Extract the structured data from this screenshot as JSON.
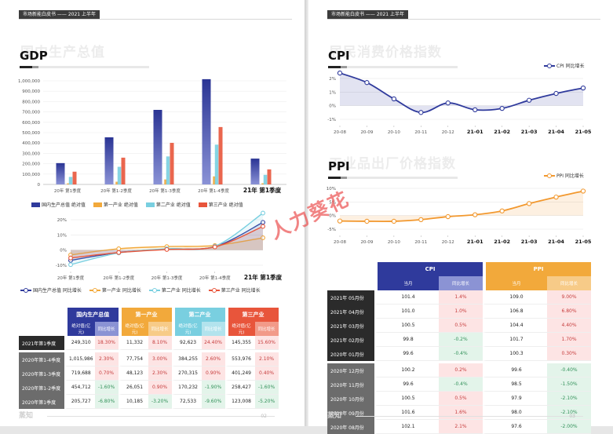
{
  "left": {
    "runhead": "市场新能白皮书 —— 2021 上半年",
    "ghost": "国内生产总值",
    "title": "GDP",
    "page_no": "02",
    "logo": "蒸知"
  },
  "right": {
    "runhead": "市场新能白皮书 —— 2021 上半年",
    "cpi_ghost": "居民消费价格指数",
    "cpi_title": "CPI",
    "ppi_ghost": "工业品出厂价格指数",
    "ppi_title": "PPI",
    "page_no": "03",
    "logo": "蒸知"
  },
  "watermark": "人力葵花",
  "colors": {
    "gdp": "#2f3a9c",
    "primary": "#f2a93b",
    "secondary": "#79cfe0",
    "tertiary": "#e8553b",
    "cpi": "#2f3a9c",
    "ppi": "#f2982e"
  },
  "chart_data": [
    {
      "type": "bar",
      "categories": [
        "20年 第1季度",
        "20年 第1-2季度",
        "20年 第1-3季度",
        "20年 第1-4季度",
        "21年 第1季度"
      ],
      "ylim": [
        0,
        1000000
      ],
      "yticks": [
        "0",
        "100,000",
        "200,000",
        "300,000",
        "400,000",
        "500,000",
        "600,000",
        "700,000",
        "800,000",
        "900,000",
        "1,000,000"
      ],
      "series": [
        {
          "name": "国内生产总值 绝对值",
          "values": [
            205727,
            454712,
            719688,
            1015986,
            249310
          ]
        },
        {
          "name": "第一产业 绝对值",
          "values": [
            10185,
            26051,
            48123,
            77754,
            11332
          ]
        },
        {
          "name": "第二产业 绝对值",
          "values": [
            72533,
            170232,
            270315,
            384255,
            92623
          ]
        },
        {
          "name": "第三产业 绝对值",
          "values": [
            123008,
            258427,
            401249,
            553976,
            145355
          ]
        }
      ]
    },
    {
      "type": "line",
      "categories": [
        "20年 第1季度",
        "20年 第1-2季度",
        "20年 第1-3季度",
        "20年 第1-4季度",
        "21年 第1季度"
      ],
      "ylim": [
        -10,
        20
      ],
      "yticks": [
        "-10%",
        "0%",
        "10%",
        "20%"
      ],
      "series": [
        {
          "name": "国内生产总值 同比增长",
          "values": [
            -6.8,
            -1.6,
            0.7,
            2.3,
            18.3
          ]
        },
        {
          "name": "第一产业 同比增长",
          "values": [
            -3.2,
            0.9,
            2.3,
            3.0,
            8.1
          ]
        },
        {
          "name": "第二产业 同比增长",
          "values": [
            -9.6,
            -1.9,
            0.9,
            2.6,
            24.4
          ]
        },
        {
          "name": "第三产业 同比增长",
          "values": [
            -5.2,
            -1.6,
            0.4,
            2.1,
            15.6
          ]
        }
      ]
    },
    {
      "type": "line",
      "categories": [
        "20-08",
        "20-09",
        "20-10",
        "20-11",
        "20-12",
        "21-01",
        "21-02",
        "21-03",
        "21-04",
        "21-05"
      ],
      "ylim": [
        -1,
        2
      ],
      "yticks": [
        "-1%",
        "0%",
        "1%",
        "2%"
      ],
      "series": [
        {
          "name": "CPI 同比增长",
          "values": [
            2.4,
            1.7,
            0.5,
            -0.5,
            0.2,
            -0.3,
            -0.2,
            0.4,
            0.9,
            1.3
          ]
        }
      ]
    },
    {
      "type": "line",
      "categories": [
        "20-08",
        "20-09",
        "20-10",
        "20-11",
        "20-12",
        "21-01",
        "21-02",
        "21-03",
        "21-04",
        "21-05"
      ],
      "ylim": [
        -5,
        10
      ],
      "yticks": [
        "-5%",
        "0%",
        "5%",
        "10%"
      ],
      "series": [
        {
          "name": "PPI 同比增长",
          "values": [
            -2.0,
            -2.1,
            -2.1,
            -1.5,
            -0.4,
            0.3,
            1.7,
            4.4,
            6.8,
            9.0
          ]
        }
      ]
    }
  ],
  "gdp_table": {
    "groups": [
      "国内生产总值",
      "第一产业",
      "第二产业",
      "第三产业"
    ],
    "sub": [
      "绝对值(亿元)",
      "同比增长"
    ],
    "rows": [
      {
        "label": "2021年第1季度",
        "cells": [
          "249,310",
          "18.30%",
          "11,332",
          "8.10%",
          "92,623",
          "24.40%",
          "145,355",
          "15.60%"
        ],
        "signs": [
          1,
          1,
          1,
          1
        ]
      },
      {
        "label": "2020年第1-4季度",
        "cells": [
          "1,015,986",
          "2.30%",
          "77,754",
          "3.00%",
          "384,255",
          "2.60%",
          "553,976",
          "2.10%"
        ],
        "signs": [
          1,
          1,
          1,
          1
        ]
      },
      {
        "label": "2020年第1-3季度",
        "cells": [
          "719,688",
          "0.70%",
          "48,123",
          "2.30%",
          "270,315",
          "0.90%",
          "401,249",
          "0.40%"
        ],
        "signs": [
          1,
          1,
          1,
          1
        ]
      },
      {
        "label": "2020年第1-2季度",
        "cells": [
          "454,712",
          "-1.60%",
          "26,051",
          "0.90%",
          "170,232",
          "-1.90%",
          "258,427",
          "-1.60%"
        ],
        "signs": [
          0,
          1,
          0,
          0
        ]
      },
      {
        "label": "2020年第1季度",
        "cells": [
          "205,727",
          "-6.80%",
          "10,185",
          "-3.20%",
          "72,533",
          "-9.60%",
          "123,008",
          "-5.20%"
        ],
        "signs": [
          0,
          0,
          0,
          0
        ]
      }
    ]
  },
  "price_table": {
    "groups": [
      "CPI",
      "PPI"
    ],
    "sub": [
      "当月",
      "同比增长"
    ],
    "rows": [
      {
        "label": "2021年 05月份",
        "cells": [
          "101.4",
          "1.4%",
          "109.0",
          "9.00%"
        ],
        "signs": [
          1,
          1
        ],
        "dark": true
      },
      {
        "label": "2021年 04月份",
        "cells": [
          "101.0",
          "1.0%",
          "106.8",
          "6.80%"
        ],
        "signs": [
          1,
          1
        ],
        "dark": true
      },
      {
        "label": "2021年 03月份",
        "cells": [
          "100.5",
          "0.5%",
          "104.4",
          "4.40%"
        ],
        "signs": [
          1,
          1
        ],
        "dark": true
      },
      {
        "label": "2021年 02月份",
        "cells": [
          "99.8",
          "-0.2%",
          "101.7",
          "1.70%"
        ],
        "signs": [
          0,
          1
        ],
        "dark": true
      },
      {
        "label": "2020年 01月份",
        "cells": [
          "99.6",
          "-0.4%",
          "100.3",
          "0.30%"
        ],
        "signs": [
          0,
          1
        ],
        "dark": true
      },
      {
        "label": "2020年 12月份",
        "cells": [
          "100.2",
          "0.2%",
          "99.6",
          "-0.40%"
        ],
        "signs": [
          1,
          0
        ],
        "dark": false
      },
      {
        "label": "2020年 11月份",
        "cells": [
          "99.6",
          "-0.4%",
          "98.5",
          "-1.50%"
        ],
        "signs": [
          0,
          0
        ],
        "dark": false
      },
      {
        "label": "2020年 10月份",
        "cells": [
          "100.5",
          "0.5%",
          "97.9",
          "-2.10%"
        ],
        "signs": [
          1,
          0
        ],
        "dark": false
      },
      {
        "label": "2020年 09月份",
        "cells": [
          "101.6",
          "1.6%",
          "98.0",
          "-2.10%"
        ],
        "signs": [
          1,
          0
        ],
        "dark": false
      },
      {
        "label": "2020年 08月份",
        "cells": [
          "102.1",
          "2.1%",
          "97.6",
          "-2.00%"
        ],
        "signs": [
          1,
          0
        ],
        "dark": false
      }
    ]
  }
}
